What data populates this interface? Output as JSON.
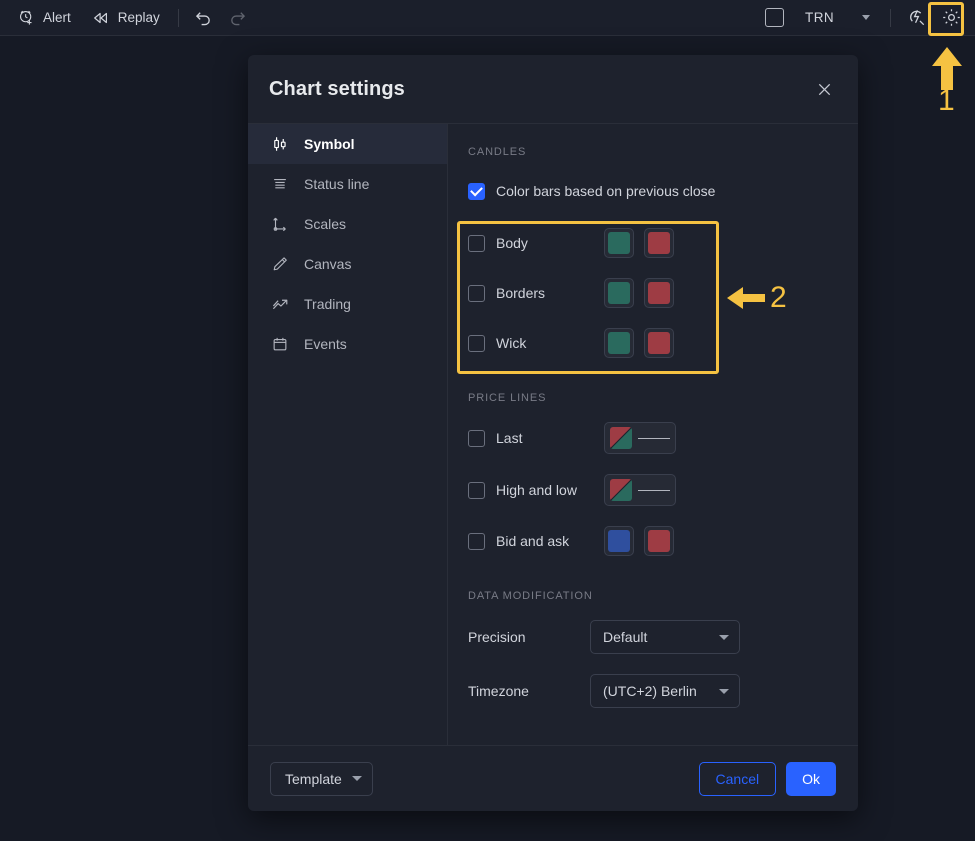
{
  "toolbar": {
    "alert_label": "Alert",
    "replay_label": "Replay",
    "undo_icon": "undo-arrow-icon",
    "redo_icon": "redo-arrow-icon",
    "layout_icon": "single-layout-icon",
    "session_label": "TRN",
    "session_chevron": "chevron-down-icon",
    "quick_search_icon": "fast-search-icon",
    "settings_icon": "gear-icon"
  },
  "annotations": [
    {
      "id": "1",
      "label": "1",
      "target": "chart-settings-gear-button"
    },
    {
      "id": "2",
      "label": "2",
      "target": "candles-colors-group"
    }
  ],
  "dialog": {
    "title": "Chart settings",
    "close_icon": "close-icon",
    "sidebar": {
      "items": [
        {
          "label": "Symbol",
          "icon": "candlestick-icon",
          "active": true
        },
        {
          "label": "Status line",
          "icon": "status-line-icon",
          "active": false
        },
        {
          "label": "Scales",
          "icon": "axes-icon",
          "active": false
        },
        {
          "label": "Canvas",
          "icon": "pencil-icon",
          "active": false
        },
        {
          "label": "Trading",
          "icon": "trading-icon",
          "active": false
        },
        {
          "label": "Events",
          "icon": "calendar-icon",
          "active": false
        }
      ]
    },
    "sections": {
      "candles": {
        "title": "CANDLES",
        "color_bars": {
          "label": "Color bars based on previous close",
          "checked": true
        },
        "rows": [
          {
            "label": "Body",
            "checked": false,
            "up_color": "#2a6a5e",
            "down_color": "#9e3c44"
          },
          {
            "label": "Borders",
            "checked": false,
            "up_color": "#2a6a5e",
            "down_color": "#9e3c44"
          },
          {
            "label": "Wick",
            "checked": false,
            "up_color": "#2a6a5e",
            "down_color": "#9e3c44"
          }
        ]
      },
      "price_lines": {
        "title": "PRICE LINES",
        "rows": [
          {
            "label": "Last",
            "checked": false,
            "type": "split-line",
            "up_color": "#2a6a5e",
            "down_color": "#9e3c44"
          },
          {
            "label": "High and low",
            "checked": false,
            "type": "split-line",
            "up_color": "#2a6a5e",
            "down_color": "#9e3c44"
          },
          {
            "label": "Bid and ask",
            "checked": false,
            "type": "two-swatch",
            "up_color": "#2f4f9e",
            "down_color": "#9e3c44"
          }
        ]
      },
      "data_modification": {
        "title": "DATA MODIFICATION",
        "precision": {
          "label": "Precision",
          "value": "Default"
        },
        "timezone": {
          "label": "Timezone",
          "value": "(UTC+2) Berlin"
        }
      }
    },
    "footer": {
      "template_label": "Template",
      "cancel_label": "Cancel",
      "ok_label": "Ok"
    }
  },
  "colors": {
    "accent_blue": "#2962ff",
    "highlight_yellow": "#f5c242",
    "page_bg": "#161a25",
    "dialog_bg": "#1e222d"
  }
}
